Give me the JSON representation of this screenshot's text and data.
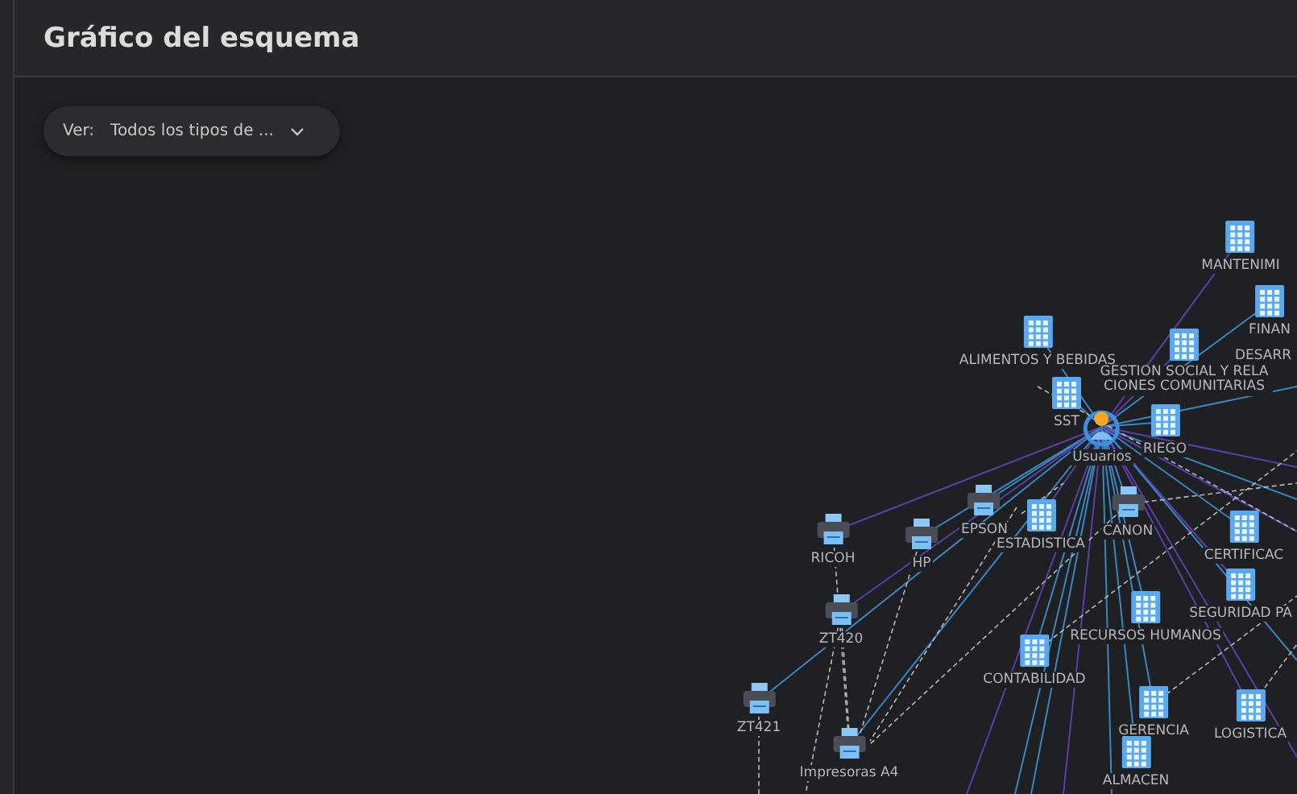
{
  "panel": {
    "title": "Gráfico del esquema"
  },
  "view_filter": {
    "label": "Ver:",
    "value": "Todos los tipos de ..."
  },
  "nodes": [
    {
      "kind": "building",
      "label": "MANTENIMI"
    },
    {
      "kind": "building",
      "label": "FINAN"
    },
    {
      "kind": "label",
      "label": "DESARR"
    },
    {
      "kind": "building",
      "label": "ALIMENTOS Y BEBIDAS"
    },
    {
      "kind": "building",
      "label": "GESTION SOCIAL Y RELACIONES COMUNITARIAS"
    },
    {
      "kind": "building",
      "label": "RIEGO"
    },
    {
      "kind": "building",
      "label": "SST"
    },
    {
      "kind": "users",
      "label": "Usuarios"
    },
    {
      "kind": "printer",
      "label": "RICOH"
    },
    {
      "kind": "printer",
      "label": "HP"
    },
    {
      "kind": "printer",
      "label": "EPSON"
    },
    {
      "kind": "building",
      "label": "ESTADISTICA"
    },
    {
      "kind": "printer",
      "label": "CANON"
    },
    {
      "kind": "building",
      "label": "CERTIFICAC"
    },
    {
      "kind": "building",
      "label": "SEGURIDAD PA"
    },
    {
      "kind": "building",
      "label": "RECURSOS HUMANOS"
    },
    {
      "kind": "building",
      "label": "CONTABILIDAD"
    },
    {
      "kind": "printer",
      "label": "ZT420"
    },
    {
      "kind": "printer",
      "label": "ZT421"
    },
    {
      "kind": "building",
      "label": "GERENCIA"
    },
    {
      "kind": "building",
      "label": "LOGISTICA"
    },
    {
      "kind": "printer",
      "label": "Impresoras A4"
    },
    {
      "kind": "building",
      "label": "ALMACEN"
    }
  ]
}
